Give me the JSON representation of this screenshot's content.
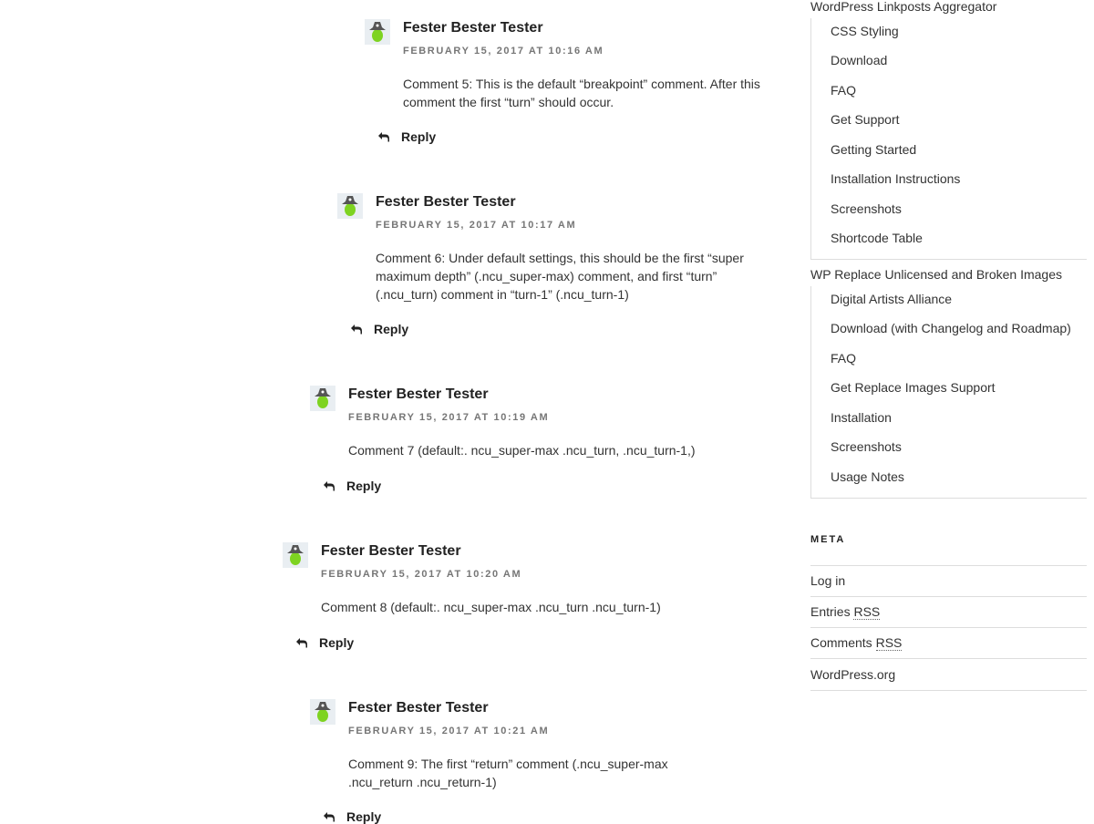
{
  "comments": [
    {
      "author": "Fester Bester Tester",
      "date": "FEBRUARY 15, 2017 AT 10:16 AM",
      "text": "Comment 5: This is the default “breakpoint” comment. After this comment the first “turn” should occur.",
      "reply_label": "Reply"
    },
    {
      "author": "Fester Bester Tester",
      "date": "FEBRUARY 15, 2017 AT 10:17 AM",
      "text": "Comment 6: Under default settings, this should be the first “super maximum depth” (.ncu_super-max) comment, and first “turn” (.ncu_turn) comment in “turn-1” (.ncu_turn-1)",
      "reply_label": "Reply"
    },
    {
      "author": "Fester Bester Tester",
      "date": "FEBRUARY 15, 2017 AT 10:19 AM",
      "text": "Comment 7 (default:. ncu_super-max .ncu_turn, .ncu_turn-1,)",
      "reply_label": "Reply"
    },
    {
      "author": "Fester Bester Tester",
      "date": "FEBRUARY 15, 2017 AT 10:20 AM",
      "text": "Comment 8 (default:. ncu_super-max .ncu_turn .ncu_turn-1)",
      "reply_label": "Reply"
    },
    {
      "author": "Fester Bester Tester",
      "date": "FEBRUARY 15, 2017 AT 10:21 AM",
      "text": "Comment 9: The first “return” comment (.ncu_super-max .ncu_return .ncu_return-1)",
      "reply_label": "Reply"
    }
  ],
  "sidebar": {
    "pages": [
      {
        "title": "WordPress Linkposts Aggregator",
        "children": [
          "CSS Styling",
          "Download",
          "FAQ",
          "Get Support",
          "Getting Started",
          "Installation Instructions",
          "Screenshots",
          "Shortcode Table"
        ]
      },
      {
        "title": "WP Replace Unlicensed and Broken Images",
        "children": [
          "Digital Artists Alliance",
          "Download (with Changelog and Roadmap)",
          "FAQ",
          "Get Replace Images Support",
          "Installation",
          "Screenshots",
          "Usage Notes"
        ]
      }
    ],
    "meta": {
      "title": "META",
      "login": "Log in",
      "entries_prefix": "Entries",
      "entries_abbr": "RSS",
      "comments_prefix": "Comments",
      "comments_abbr": "RSS",
      "wordpress_org": "WordPress.org"
    }
  },
  "icons": {
    "avatar": "avatar-icon",
    "reply": "reply-arrow-icon"
  },
  "colors": {
    "avatar_face": "#7ed321",
    "avatar_hat": "#555555",
    "date_text": "#767676",
    "divider": "#dddddd"
  }
}
